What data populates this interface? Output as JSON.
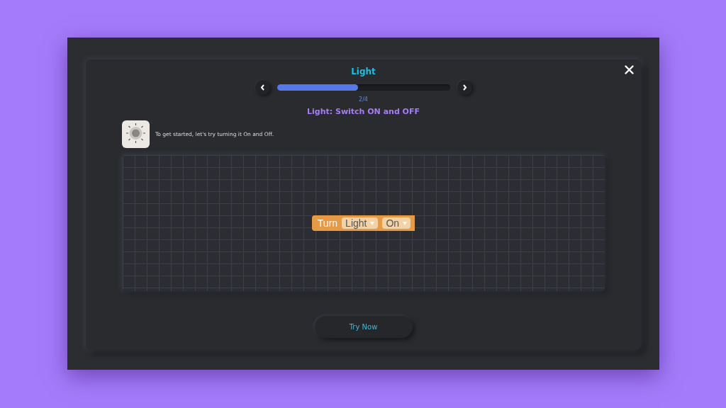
{
  "dialog": {
    "title": "Light",
    "progress": {
      "level": 0.47,
      "reading": "2/4"
    },
    "step_title": "Light: Switch ON and OFF",
    "instruction": "To get started, let's try turning it On and Off.",
    "block": {
      "keyword": "Turn",
      "fields": [
        "Light",
        "On"
      ]
    },
    "button": "Try Now"
  }
}
